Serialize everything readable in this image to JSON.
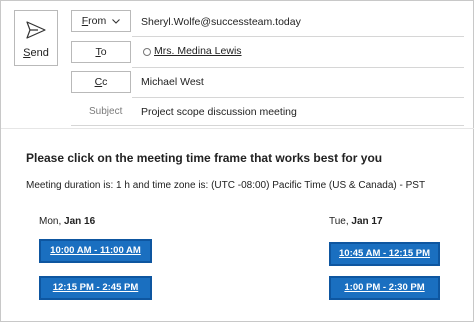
{
  "header": {
    "send_label": "Send",
    "from_label": "From",
    "from_value": "Sheryl.Wolfe@successteam.today",
    "to_label": "To",
    "to_value": "Mrs. Medina Lewis",
    "cc_label": "Cc",
    "cc_value": "Michael West",
    "subject_label": "Subject",
    "subject_value": "Project scope discussion meeting"
  },
  "body": {
    "heading": "Please click on the meeting time frame that works best for you",
    "duration": "Meeting duration is: 1 h and time zone is: (UTC -08:00) Pacific Time (US & Canada) - PST",
    "days": [
      {
        "weekday": "Mon, ",
        "date": "Jan 16",
        "slots": [
          "10:00 AM - 11:00 AM",
          "12:15 PM - 2:45 PM"
        ]
      },
      {
        "weekday": "Tue, ",
        "date": "Jan 17",
        "slots": [
          "10:45 AM - 12:15 PM",
          "1:00 PM - 2:30 PM"
        ]
      }
    ]
  },
  "colors": {
    "slot_button": "#1a6fc0",
    "slot_border": "#0e56a0",
    "slot_text": "#ffffff"
  },
  "icons": {
    "send": "send-icon",
    "from_dropdown": "chevron-down-icon",
    "to_recipient_status": "radio-circle-icon"
  }
}
